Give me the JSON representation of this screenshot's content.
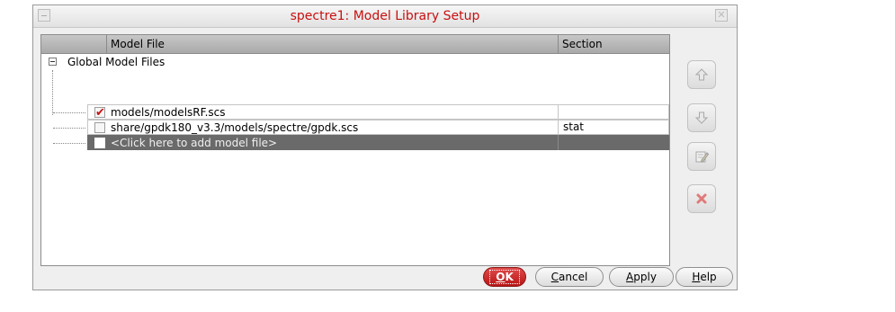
{
  "window": {
    "title": "spectre1: Model Library Setup"
  },
  "table": {
    "headers": {
      "model_file": "Model File",
      "section": "Section"
    },
    "group_label": "Global Model Files",
    "rows": [
      {
        "file": "models/modelsRF.scs",
        "section": "",
        "checked": true
      },
      {
        "file": "share/gpdk180_v3.3/models/spectre/gpdk.scs",
        "section": "stat",
        "checked": false
      },
      {
        "file": "<Click here to add model file>",
        "section": "",
        "checked": false,
        "selected": true
      }
    ]
  },
  "side_buttons": [
    "move-up-icon",
    "move-down-icon",
    "edit-icon",
    "delete-icon"
  ],
  "buttons": {
    "ok": {
      "mnemonic": "O",
      "rest": "K"
    },
    "cancel": {
      "mnemonic": "C",
      "rest": "ancel"
    },
    "apply": {
      "mnemonic": "A",
      "rest": "pply"
    },
    "help": {
      "mnemonic": "H",
      "rest": "elp"
    }
  },
  "colors": {
    "title": "#c81010",
    "accent": "#c81a1a",
    "selection": "#6a6a6a"
  }
}
